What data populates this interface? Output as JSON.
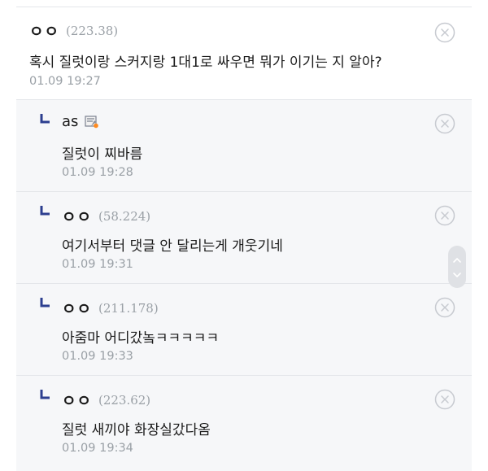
{
  "comments": [
    {
      "nickname": "ㅇㅇ",
      "ip": "(223.38)",
      "text": "혹시 질럿이랑 스커지랑 1대1로 싸우면 뭐가 이기는 지 알아?",
      "time": "01.09 19:27"
    }
  ],
  "replies": [
    {
      "nickname": "as",
      "ip": "",
      "badge_icon": "gallery-manager-badge-icon",
      "text": "질럿이 찌바름",
      "time": "01.09 19:28"
    },
    {
      "nickname": "ㅇㅇ",
      "ip": "(58.224)",
      "text": "여기서부터 댓글 안 달리는게 개웃기네",
      "time": "01.09 19:31"
    },
    {
      "nickname": "ㅇㅇ",
      "ip": "(211.178)",
      "text": "아줌마 어디갔놐ㅋㅋㅋㅋㅋ",
      "time": "01.09 19:33"
    },
    {
      "nickname": "ㅇㅇ",
      "ip": "(223.62)",
      "text": "질럿 새끼야 화장실갔다옴",
      "time": "01.09 19:34"
    }
  ],
  "icons": {
    "delete": "close-circle-icon",
    "reply_marker": "reply-arrow-icon",
    "scroll_up": "chevron-up-icon",
    "scroll_down": "chevron-down-icon"
  },
  "colors": {
    "reply_marker": "#2c3e8f",
    "meta_text": "#9aa0a6",
    "reply_background": "#f6f7f9",
    "divider": "#e4e6ea"
  }
}
